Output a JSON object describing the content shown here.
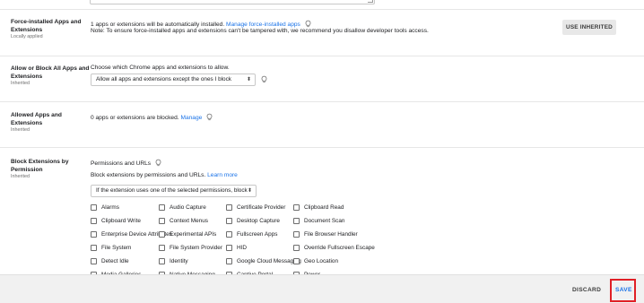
{
  "rows": {
    "force_installed": {
      "title": "Force-installed Apps and Extensions",
      "status": "Locally applied",
      "line1_text": "1 apps or extensions will be automatically installed.",
      "line1_link": "Manage force-installed apps",
      "line2_text": "Note: To ensure force-installed apps and extensions can't be tampered with, we recommend you disallow developer tools access.",
      "button": "USE INHERITED"
    },
    "allow_block": {
      "title": "Allow or Block All Apps and Extensions",
      "status": "Inherited",
      "prompt": "Choose which Chrome apps and extensions to allow.",
      "select_value": "Allow all apps and extensions except the ones I block"
    },
    "allowed": {
      "title": "Allowed Apps and Extensions",
      "status": "Inherited",
      "text": "0 apps or extensions are blocked.",
      "link": "Manage"
    },
    "block_permission": {
      "title": "Block Extensions by Permission",
      "status": "Inherited",
      "subheading": "Permissions and URLs",
      "description": "Block extensions by permissions and URLs.",
      "learn_more": "Learn more",
      "select_value": "If the extension uses one of the selected permissions, block"
    }
  },
  "permissions": {
    "col1": [
      "Alarms",
      "Clipboard Write",
      "Enterprise Device Attributes",
      "File System",
      "Detect Idle",
      "Media Galleries"
    ],
    "col2": [
      "Audio Capture",
      "Context Menus",
      "Experimental APIs",
      "File System Provider",
      "Identity",
      "Native Messaging"
    ],
    "col3": [
      "Certificate Provider",
      "Desktop Capture",
      "Fullscreen Apps",
      "HID",
      "Google Cloud Messaging",
      "Captive Portal"
    ],
    "col4": [
      "Clipboard Read",
      "Document Scan",
      "File Browser Handler",
      "Override Fullscreen Escape",
      "Geo Location",
      "Power"
    ]
  },
  "footer": {
    "discard": "DISCARD",
    "save": "SAVE"
  },
  "icons": {
    "hint": "lightbulb-icon",
    "select_arrows": "updown-icon"
  },
  "colors": {
    "link": "#1a73e8",
    "highlight": "#e01f26",
    "footer_bg": "#f1f1f1"
  }
}
